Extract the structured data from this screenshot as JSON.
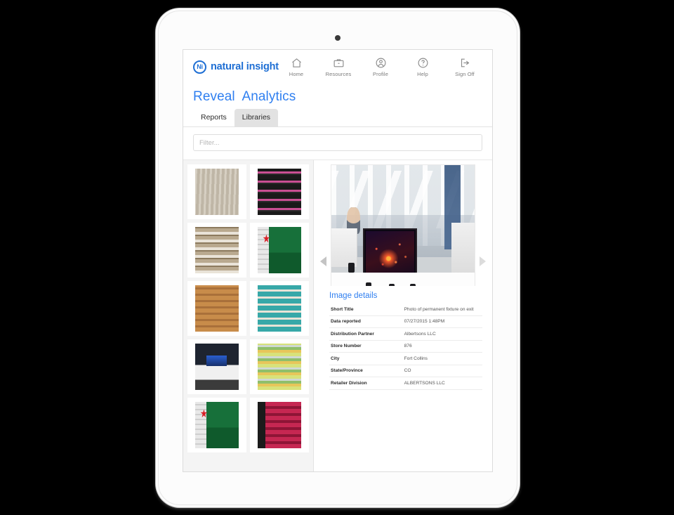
{
  "app": {
    "brand": {
      "mark": "Ni",
      "name": "natural insight"
    },
    "nav": [
      {
        "label": "Home",
        "icon": "home-icon"
      },
      {
        "label": "Resources",
        "icon": "briefcase-icon"
      },
      {
        "label": "Profile",
        "icon": "profile-icon"
      },
      {
        "label": "Help",
        "icon": "help-icon"
      },
      {
        "label": "Sign Off",
        "icon": "sign-off-icon"
      }
    ],
    "page_title": "Reveal  Analytics",
    "tabs": [
      {
        "label": "Reports",
        "active": false
      },
      {
        "label": "Libraries",
        "active": true
      }
    ],
    "filter": {
      "value": "",
      "placeholder": "Filter..."
    },
    "gallery": {
      "prev_arrow": "triangle-left-icon",
      "next_arrow": "triangle-right-icon",
      "main_image_alt": "Sony television display fixture in electronics store",
      "thumbnails": [
        {
          "alt": "Pallet display in grocery aisle"
        },
        {
          "alt": "Dark cosmetics endcap shelf"
        },
        {
          "alt": "Packed convenience store shelving"
        },
        {
          "alt": "Heineken green beer display"
        },
        {
          "alt": "Cardboard multi-tier floor display"
        },
        {
          "alt": "Teal carton pallet stack"
        },
        {
          "alt": "Electronics table display with blue lighting"
        },
        {
          "alt": "Grocery aisle shelving"
        },
        {
          "alt": "Heineken green beer display"
        },
        {
          "alt": "Red and pink beverage endcap display"
        }
      ]
    },
    "details": {
      "heading": "Image details",
      "rows": [
        {
          "key": "Short Title",
          "value": "Photo of permanent fixture on exit"
        },
        {
          "key": "Data reported",
          "value": "07/27/2015 1:48PM"
        },
        {
          "key": "Distribution Partner",
          "value": "Albertsons LLC"
        },
        {
          "key": "Store Number",
          "value": "876"
        },
        {
          "key": "City",
          "value": "Fort Collins"
        },
        {
          "key": "State/Province",
          "value": "CO"
        },
        {
          "key": "Retailer Division",
          "value": "ALBERTSONS LLC"
        }
      ]
    },
    "colors": {
      "brand_blue": "#1f6fd4",
      "title_blue": "#2f7ff0",
      "tab_active_bg": "#e2e2e2",
      "panel_bg": "#f4f4f4"
    }
  }
}
